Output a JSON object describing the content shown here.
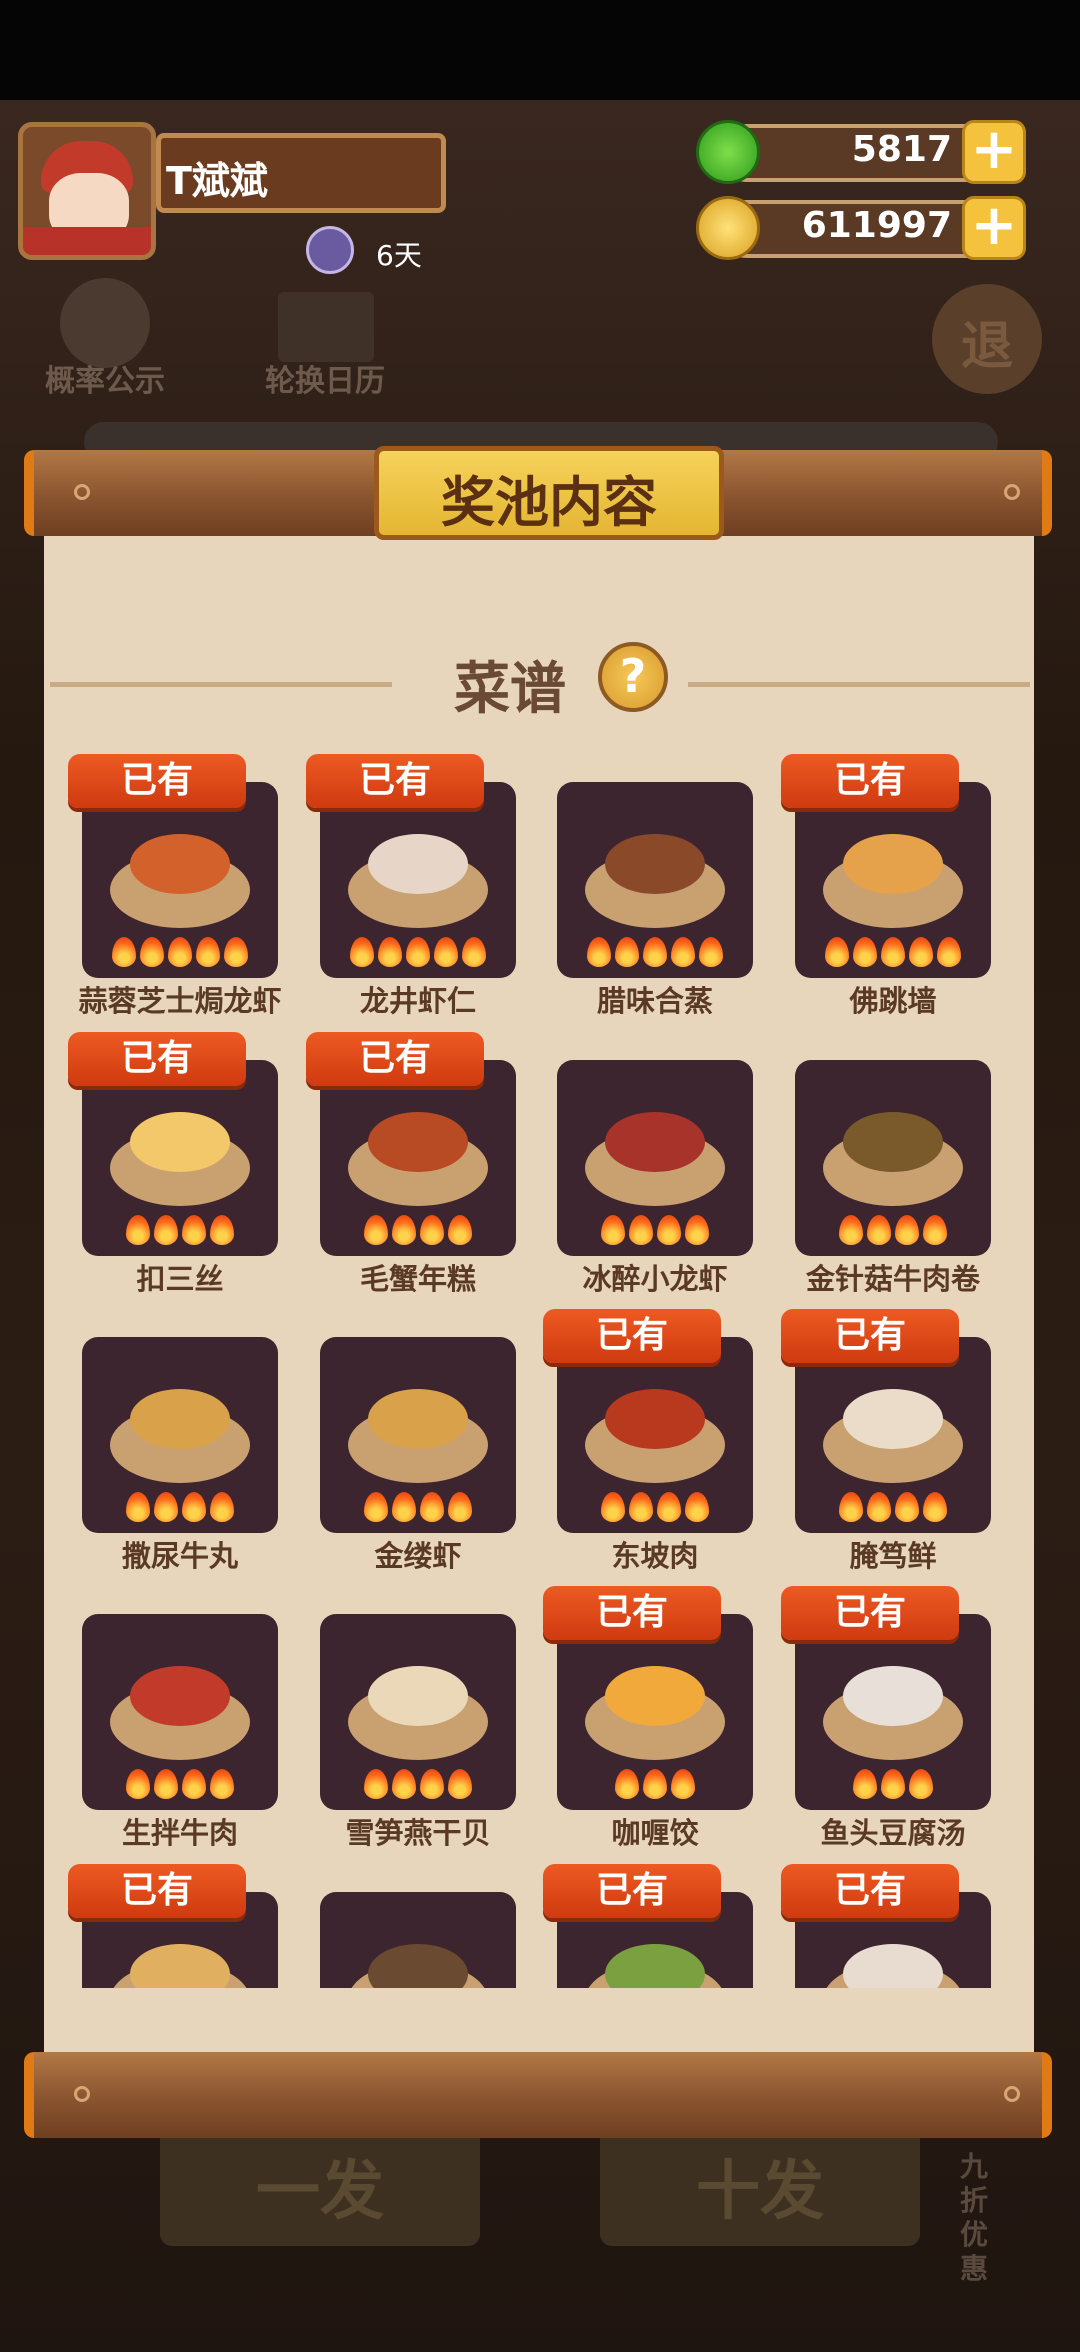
{
  "header": {
    "player_name": "T斌斌",
    "vip_days": "6天",
    "jade_amount": "5817",
    "coin_amount": "611997",
    "plus_symbol": "+"
  },
  "background": {
    "probability_label": "概率公示",
    "calendar_label": "轮换日历",
    "exit_label": "退",
    "btn_once": "一发",
    "btn_ten": "十发",
    "discount_label": "九折优惠"
  },
  "panel": {
    "title": "奖池内容",
    "section_title": "菜谱",
    "help_symbol": "?",
    "owned_label": "已有"
  },
  "recipes": [
    {
      "name": "蒜蓉芝士焗龙虾",
      "owned": true,
      "stars": 5,
      "color": "#d3612b"
    },
    {
      "name": "龙井虾仁",
      "owned": true,
      "stars": 5,
      "color": "#e7d6c8"
    },
    {
      "name": "腊味合蒸",
      "owned": false,
      "stars": 5,
      "color": "#8a4a2a"
    },
    {
      "name": "佛跳墙",
      "owned": true,
      "stars": 5,
      "color": "#e5a24a"
    },
    {
      "name": "扣三丝",
      "owned": true,
      "stars": 4,
      "color": "#f3c86a"
    },
    {
      "name": "毛蟹年糕",
      "owned": true,
      "stars": 4,
      "color": "#b84a24"
    },
    {
      "name": "冰醉小龙虾",
      "owned": false,
      "stars": 4,
      "color": "#a8332a"
    },
    {
      "name": "金针菇牛肉卷",
      "owned": false,
      "stars": 4,
      "color": "#7a5a2a"
    },
    {
      "name": "撒尿牛丸",
      "owned": false,
      "stars": 4,
      "color": "#d9a24a"
    },
    {
      "name": "金缕虾",
      "owned": false,
      "stars": 4,
      "color": "#d9a24a"
    },
    {
      "name": "东坡肉",
      "owned": true,
      "stars": 4,
      "color": "#b8391e"
    },
    {
      "name": "腌笃鲜",
      "owned": true,
      "stars": 4,
      "color": "#eadcc8"
    },
    {
      "name": "生拌牛肉",
      "owned": false,
      "stars": 4,
      "color": "#c23a2a"
    },
    {
      "name": "雪笋燕干贝",
      "owned": false,
      "stars": 4,
      "color": "#ead8b8"
    },
    {
      "name": "咖喱饺",
      "owned": true,
      "stars": 3,
      "color": "#f0a93a"
    },
    {
      "name": "鱼头豆腐汤",
      "owned": true,
      "stars": 3,
      "color": "#e8e0d8"
    },
    {
      "name": "",
      "owned": true,
      "stars": 0,
      "color": "#e0b060"
    },
    {
      "name": "",
      "owned": false,
      "stars": 0,
      "color": "#6a4a30"
    },
    {
      "name": "",
      "owned": true,
      "stars": 0,
      "color": "#7aa040"
    },
    {
      "name": "",
      "owned": true,
      "stars": 0,
      "color": "#e8dcd0"
    }
  ]
}
